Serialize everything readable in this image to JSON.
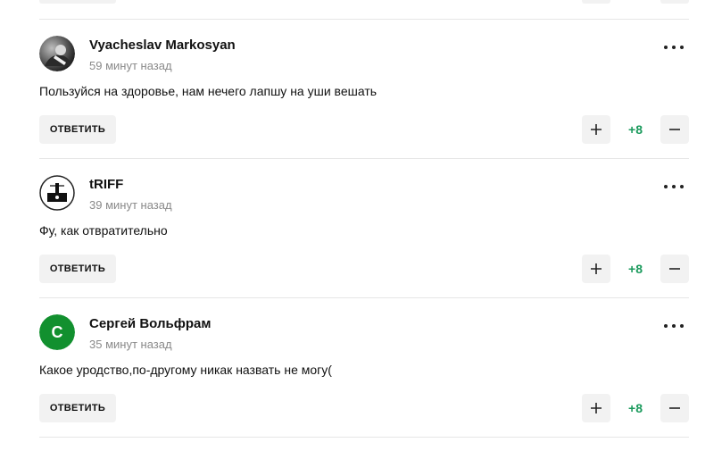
{
  "colors": {
    "score": "#1a9a5c",
    "button_bg": "#f2f2f2",
    "divider": "#e6e6e6",
    "time": "#8a8a8a",
    "avatar_sergey": "#12902f"
  },
  "icons": {
    "more": "more-dots-icon",
    "plus": "plus-icon",
    "minus": "minus-icon"
  },
  "comments": [
    {
      "author": "Vyacheslav Markosyan",
      "time": "59 минут назад",
      "text": "Пользуйся на здоровье, нам нечего лапшу на уши вешать",
      "reply_label": "ОТВЕТИТЬ",
      "score": "+8"
    },
    {
      "author": "tRIFF",
      "time": "39 минут назад",
      "text": "Фу, как отвратительно",
      "reply_label": "ОТВЕТИТЬ",
      "score": "+8"
    },
    {
      "author": "Сергей Вольфрам",
      "avatar_letter": "С",
      "time": "35 минут назад",
      "text": "Какое уродство,по-другому никак назвать не могу(",
      "reply_label": "ОТВЕТИТЬ",
      "score": "+8"
    }
  ]
}
